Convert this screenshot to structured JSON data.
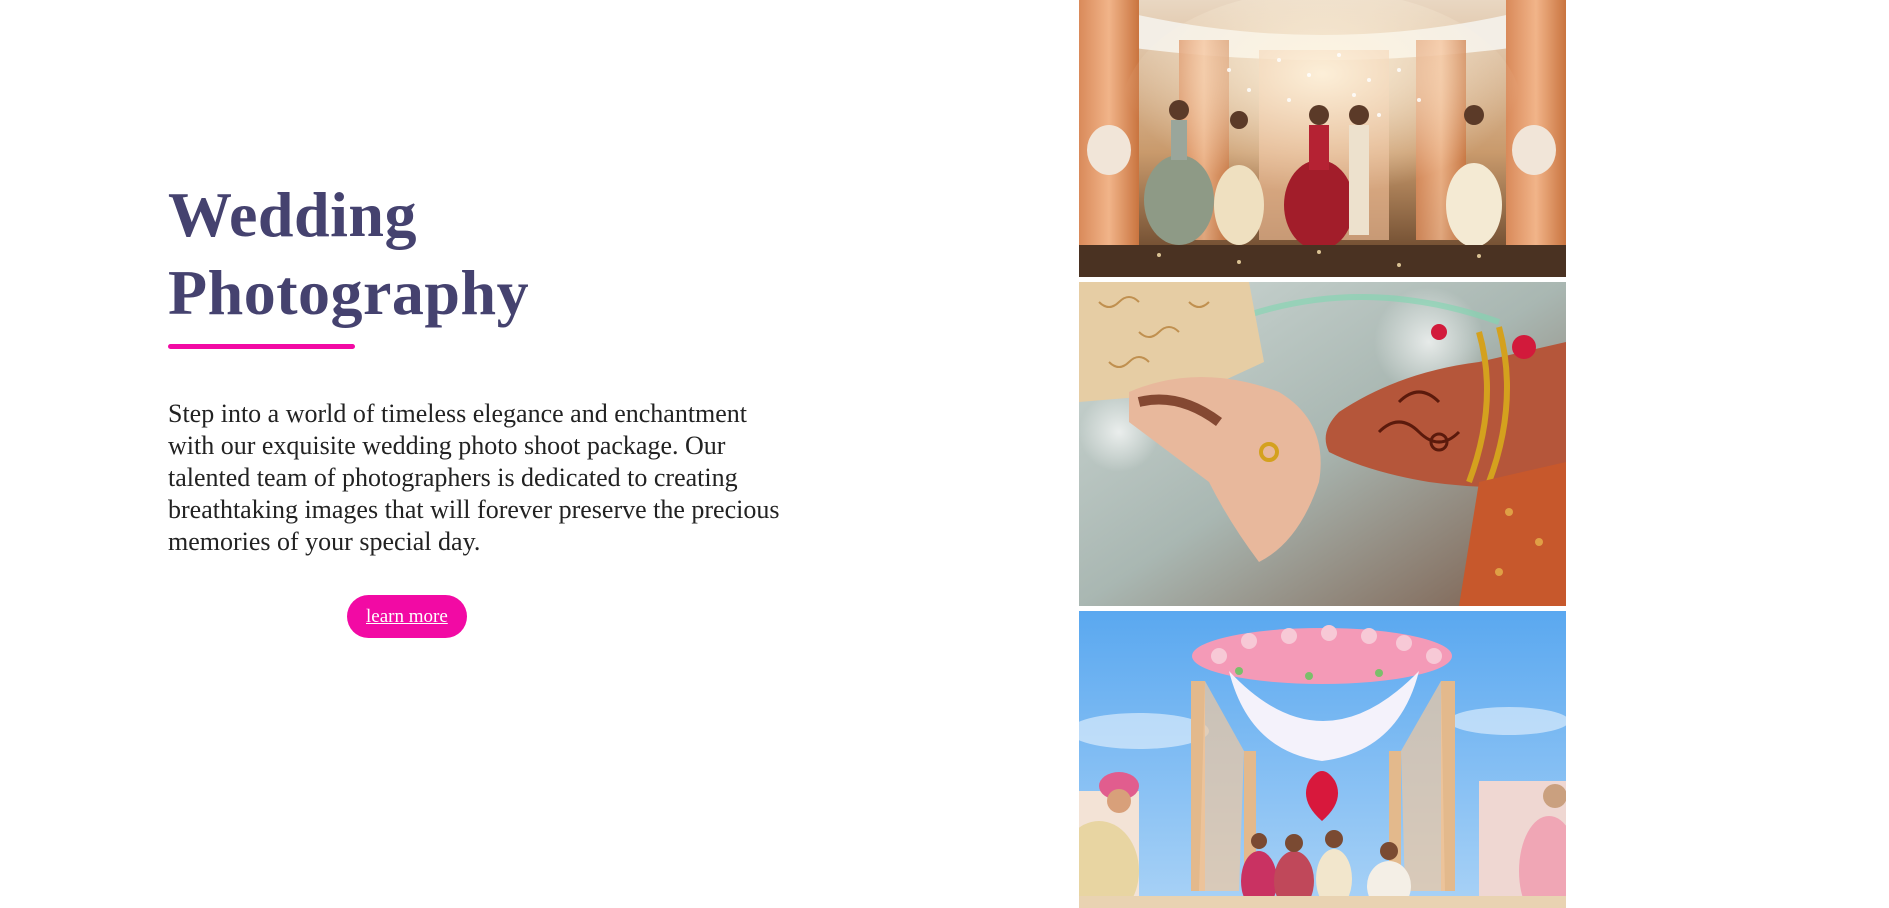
{
  "hero": {
    "title_line1": "Wedding",
    "title_line2": "Photography",
    "description": "Step into a world of timeless elegance and enchantment with our exquisite wedding photo shoot package. Our talented team of photographers is dedicated to creating breathtaking images that will forever preserve the precious memories of your special day.",
    "button_label": "learn more"
  },
  "gallery": {
    "photos": [
      {
        "subject": "wedding-ceremony-stage-with-flower-petals"
      },
      {
        "subject": "holding-hands-with-henna"
      },
      {
        "subject": "floral-mandap-outdoor-ceremony"
      }
    ]
  },
  "colors": {
    "title": "#45426f",
    "accent": "#f20aa4",
    "body_text": "#222222",
    "background": "#ffffff"
  }
}
